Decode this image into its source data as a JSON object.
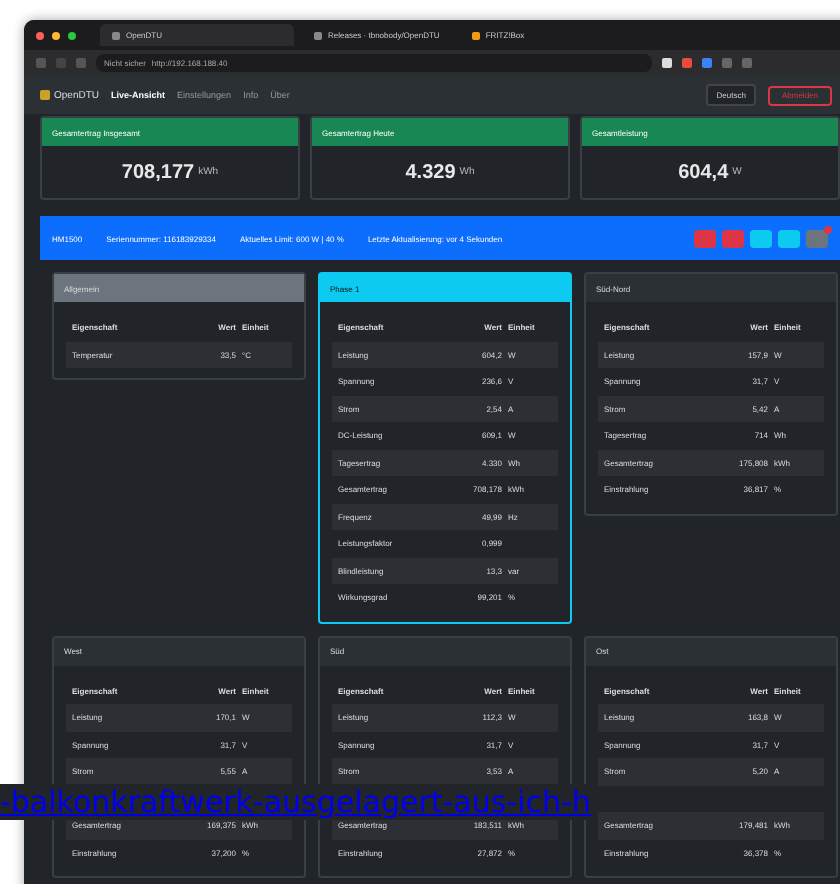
{
  "browser": {
    "tabs": [
      {
        "label": "OpenDTU",
        "selected": true
      },
      {
        "label": "Releases · tbnobody/OpenDTU",
        "selected": false
      },
      {
        "label": "FRITZ!Box",
        "selected": false
      }
    ],
    "security": "Nicht sicher",
    "url": "http://192.168.188.40"
  },
  "nav": {
    "brand": "OpenDTU",
    "items": [
      {
        "label": "Live-Ansicht",
        "selected": true
      },
      {
        "label": "Einstellungen",
        "selected": false
      },
      {
        "label": "Info",
        "selected": false
      },
      {
        "label": "Über",
        "selected": false
      }
    ],
    "language": "Deutsch",
    "logout": "Abmelden"
  },
  "stats": [
    {
      "title": "Gesamtertrag Insgesamt",
      "value": "708,177",
      "unit": "kWh"
    },
    {
      "title": "Gesamtertrag Heute",
      "value": "4.329",
      "unit": "Wh"
    },
    {
      "title": "Gesamtleistung",
      "value": "604,4",
      "unit": "W"
    }
  ],
  "inverter": {
    "name": "HM1500",
    "serial": "Seriennummer: 116183929334",
    "limit": "Aktuelles Limit: 600 W | 40 %",
    "updated": "Letzte Aktualisierung: vor 4 Sekunden",
    "actions": [
      {
        "kind": "danger"
      },
      {
        "kind": "danger"
      },
      {
        "kind": "info"
      },
      {
        "kind": "info"
      },
      {
        "kind": "secondary",
        "badge": true
      }
    ]
  },
  "panels": [
    {
      "title": "Allgemein",
      "kind": "general",
      "columns": [
        "Eigenschaft",
        "Wert",
        "Einheit"
      ],
      "rows": [
        [
          "Temperatur",
          "33,5",
          "°C"
        ]
      ]
    },
    {
      "title": "Phase 1",
      "kind": "ac",
      "columns": [
        "Eigenschaft",
        "Wert",
        "Einheit"
      ],
      "rows": [
        [
          "Leistung",
          "604,2",
          "W"
        ],
        [
          "Spannung",
          "236,6",
          "V"
        ],
        [
          "Strom",
          "2,54",
          "A"
        ],
        [
          "DC-Leistung",
          "609,1",
          "W"
        ],
        [
          "Tagesertrag",
          "4.330",
          "Wh"
        ],
        [
          "Gesamtertrag",
          "708,178",
          "kWh"
        ],
        [
          "Frequenz",
          "49,99",
          "Hz"
        ],
        [
          "Leistungsfaktor",
          "0,999",
          ""
        ],
        [
          "Blindleistung",
          "13,3",
          "var"
        ],
        [
          "Wirkungsgrad",
          "99,201",
          "%"
        ]
      ]
    },
    {
      "title": "Süd-Nord",
      "kind": "dc",
      "columns": [
        "Eigenschaft",
        "Wert",
        "Einheit"
      ],
      "rows": [
        [
          "Leistung",
          "157,9",
          "W"
        ],
        [
          "Spannung",
          "31,7",
          "V"
        ],
        [
          "Strom",
          "5,42",
          "A"
        ],
        [
          "Tagesertrag",
          "714",
          "Wh"
        ],
        [
          "Gesamtertrag",
          "175,808",
          "kWh"
        ],
        [
          "Einstrahlung",
          "36,817",
          "%"
        ]
      ]
    },
    {
      "title": "West",
      "kind": "dc",
      "columns": [
        "Eigenschaft",
        "Wert",
        "Einheit"
      ],
      "rows": [
        [
          "Leistung",
          "170,1",
          "W"
        ],
        [
          "Spannung",
          "31,7",
          "V"
        ],
        [
          "Strom",
          "5,55",
          "A"
        ]
      ],
      "rows_below_link": [
        [
          "Gesamtertrag",
          "169,375",
          "kWh"
        ],
        [
          "Einstrahlung",
          "37,200",
          "%"
        ]
      ]
    },
    {
      "title": "Süd",
      "kind": "dc",
      "columns": [
        "Eigenschaft",
        "Wert",
        "Einheit"
      ],
      "rows": [
        [
          "Leistung",
          "112,3",
          "W"
        ],
        [
          "Spannung",
          "31,7",
          "V"
        ],
        [
          "Strom",
          "3,53",
          "A"
        ]
      ],
      "rows_below_link": [
        [
          "Gesamtertrag",
          "183,511",
          "kWh"
        ],
        [
          "Einstrahlung",
          "27,872",
          "%"
        ]
      ]
    },
    {
      "title": "Ost",
      "kind": "dc",
      "columns": [
        "Eigenschaft",
        "Wert",
        "Einheit"
      ],
      "rows": [
        [
          "Leistung",
          "163,8",
          "W"
        ],
        [
          "Spannung",
          "31,7",
          "V"
        ],
        [
          "Strom",
          "5,20",
          "A"
        ]
      ],
      "rows_below_link": [
        [
          "Gesamtertrag",
          "179,481",
          "kWh"
        ],
        [
          "Einstrahlung",
          "36,378",
          "%"
        ]
      ]
    }
  ],
  "overlay_link": "-balkonkraftwerk-ausgelagert-aus-ich-h"
}
